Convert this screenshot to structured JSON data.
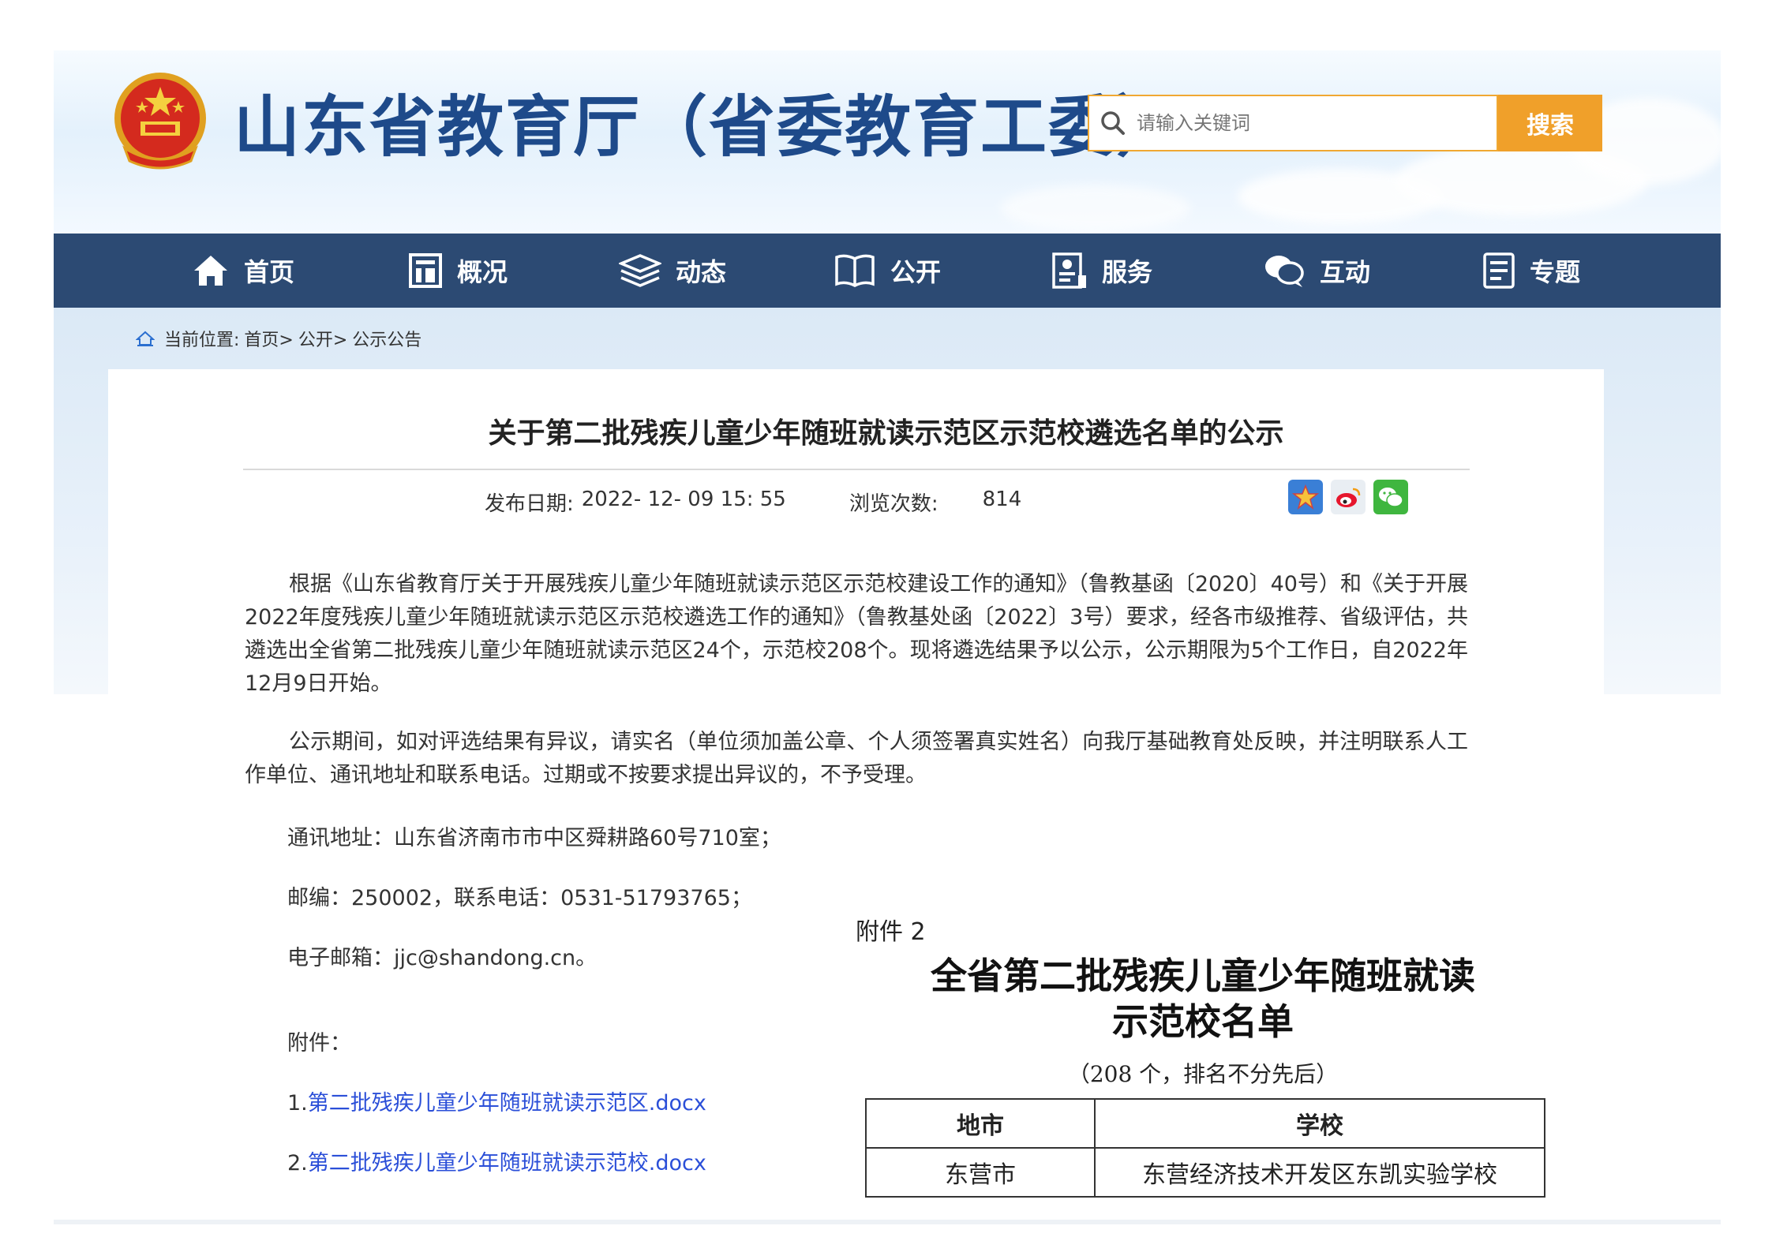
{
  "header": {
    "site_title": "山东省教育厅（省委教育工委）",
    "search_placeholder": "请输入关键词",
    "search_button": "搜索"
  },
  "nav": {
    "items": [
      {
        "label": "首页",
        "icon": "home-icon"
      },
      {
        "label": "概况",
        "icon": "building-icon"
      },
      {
        "label": "动态",
        "icon": "layers-icon"
      },
      {
        "label": "公开",
        "icon": "book-icon"
      },
      {
        "label": "服务",
        "icon": "service-icon"
      },
      {
        "label": "互动",
        "icon": "chat-icon"
      },
      {
        "label": "专题",
        "icon": "document-icon"
      }
    ]
  },
  "breadcrumb": {
    "prefix": "当前位置:",
    "items": [
      "首页>",
      "公开>",
      "公示公告"
    ]
  },
  "article": {
    "title": "关于第二批残疾儿童少年随班就读示范区示范校遴选名单的公示",
    "date_label": "发布日期:",
    "date_value": "2022- 12- 09 15: 55",
    "views_label": "浏览次数:",
    "views_value": "814",
    "paragraph1": "根据《山东省教育厅关于开展残疾儿童少年随班就读示范区示范校建设工作的通知》（鲁教基函〔2020〕40号）和《关于开展2022年度残疾儿童少年随班就读示范区示范校遴选工作的通知》（鲁教基处函〔2022〕3号）要求，经各市级推荐、省级评估，共遴选出全省第二批残疾儿童少年随班就读示范区24个，示范校208个。现将遴选结果予以公示，公示期限为5个工作日，自2022年12月9日开始。",
    "paragraph2": "公示期间，如对评选结果有异议，请实名（单位须加盖公章、个人须签署真实姓名）向我厅基础教育处反映，并注明联系人工作单位、通讯地址和联系电话。过期或不按要求提出异议的，不予受理。",
    "address": "通讯地址：山东省济南市市中区舜耕路60号710室；",
    "postcode": "邮编：250002，联系电话：0531-51793765；",
    "email": "电子邮箱：jjc@shandong.cn。",
    "attachments_label": "附件：",
    "attachment1_num": "1.",
    "attachment1": "第二批残疾儿童少年随班就读示范区.docx",
    "attachment2_num": "2.",
    "attachment2": "第二批残疾儿童少年随班就读示范校.docx"
  },
  "doc_preview": {
    "annex": "附件 2",
    "title_line1": "全省第二批残疾儿童少年随班就读",
    "title_line2": "示范校名单",
    "subtitle": "（208 个，排名不分先后）",
    "col_city": "地市",
    "col_school": "学校",
    "row1_city": "东营市",
    "row1_school": "东营经济技术开发区东凯实验学校"
  },
  "colors": {
    "brand_blue": "#1e4a8a",
    "nav_bg": "#2c4a73",
    "search_accent": "#f0a02a",
    "link": "#2b4fd8"
  }
}
